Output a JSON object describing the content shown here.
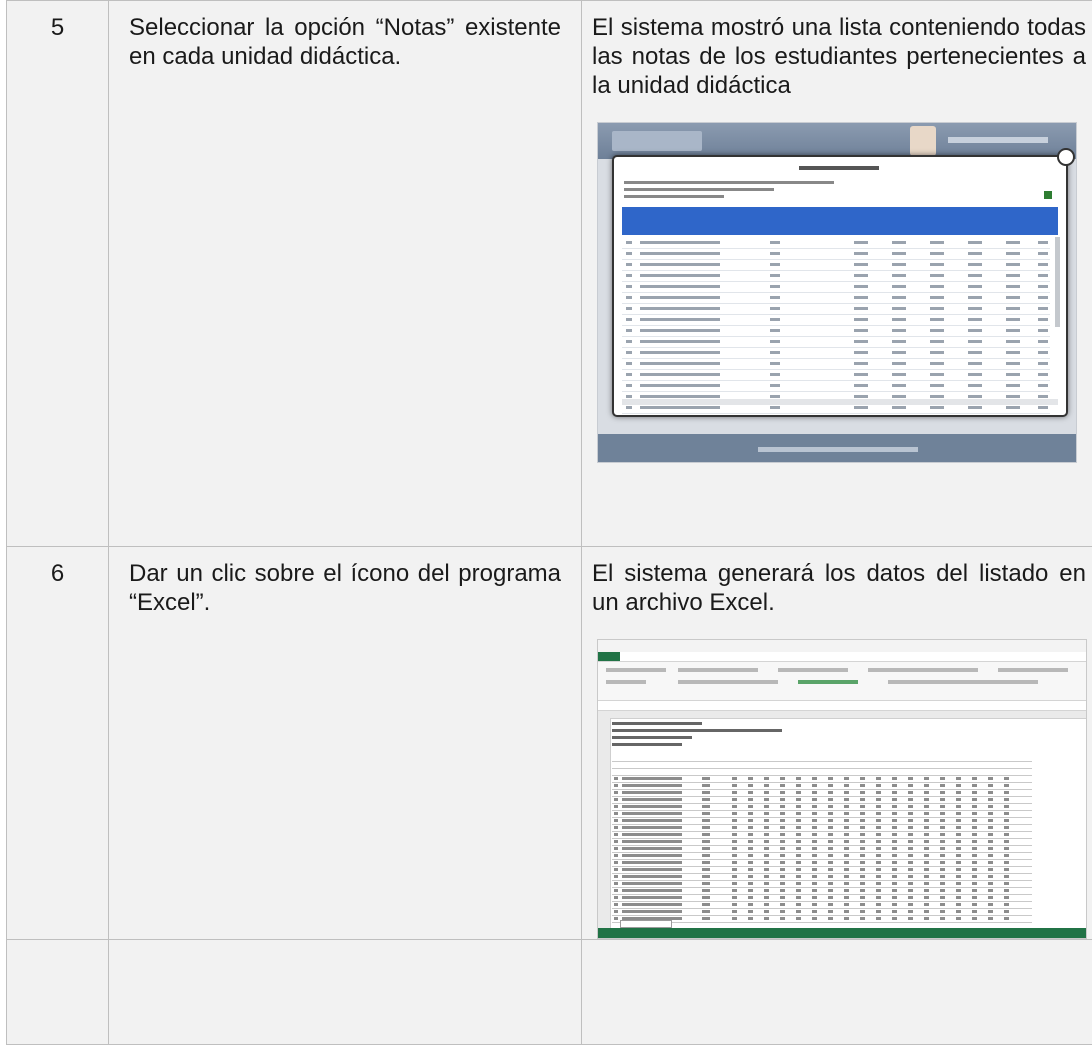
{
  "rows": [
    {
      "number": "5",
      "action": "Seleccionar la opción “Notas” existente en cada unidad didáctica.",
      "result": "El sistema mostró una lista conteniendo todas las notas de los estudiantes pertenecientes a la unidad didáctica",
      "screenshot": "notes-list-screenshot"
    },
    {
      "number": "6",
      "action": "Dar un clic sobre el ícono del programa “Excel”.",
      "result": "El sistema generará los datos del listado en un archivo Excel.",
      "screenshot": "excel-screenshot"
    },
    {
      "number": "",
      "action": "",
      "result": ""
    }
  ]
}
